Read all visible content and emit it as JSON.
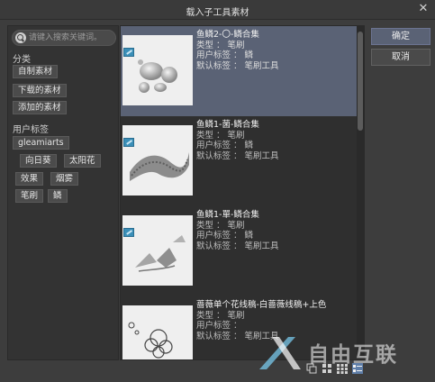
{
  "window": {
    "title": "载入子工具素材",
    "close_glyph": "✕"
  },
  "search": {
    "placeholder": "请键入搜索关键词。"
  },
  "sidebar": {
    "category_label": "分类",
    "categories": [
      "自制素材",
      "下载的素材",
      "添加的素材"
    ],
    "user_tags_label": "用户标签",
    "user_tags": [
      "gleamiarts",
      "向日葵",
      "太阳花",
      "效果",
      "烟雾",
      "笔刷",
      "鳞"
    ]
  },
  "materials": [
    {
      "name": "鱼鳞2-〇-鳞合集",
      "type_line": "类型 ： 笔刷",
      "user_tag_line": "用户标签 ： 鳞",
      "default_tag_line": "默认标签 ： 笔刷工具",
      "selected": true
    },
    {
      "name": "鱼鳞1-菌-鳞合集",
      "type_line": "类型 ： 笔刷",
      "user_tag_line": "用户标签 ： 鳞",
      "default_tag_line": "默认标签 ： 笔刷工具",
      "selected": false
    },
    {
      "name": "鱼鳞1-單-鳞合集",
      "type_line": "类型 ： 笔刷",
      "user_tag_line": "用户标签 ： 鳞",
      "default_tag_line": "默认标签 ： 笔刷工具",
      "selected": false
    },
    {
      "name": "蔷薇单个花线稿-白蔷薇线稿+上色",
      "type_line": "类型 ： 笔刷",
      "user_tag_line": "用户标签 ：",
      "default_tag_line": "默认标签 ： 笔刷工具",
      "selected": false
    }
  ],
  "buttons": {
    "ok": "确定",
    "cancel": "取消"
  },
  "view_modes": [
    "thumbnail-small-icon",
    "grid-medium-icon",
    "grid-large-icon",
    "list-detail-icon"
  ],
  "active_view_mode": "list-detail-icon",
  "watermark": {
    "text": "自由互联"
  },
  "colors": {
    "selection": "#5a6275",
    "panel": "#333333",
    "background": "#3d3d3d",
    "badge": "#3b8fb8"
  }
}
